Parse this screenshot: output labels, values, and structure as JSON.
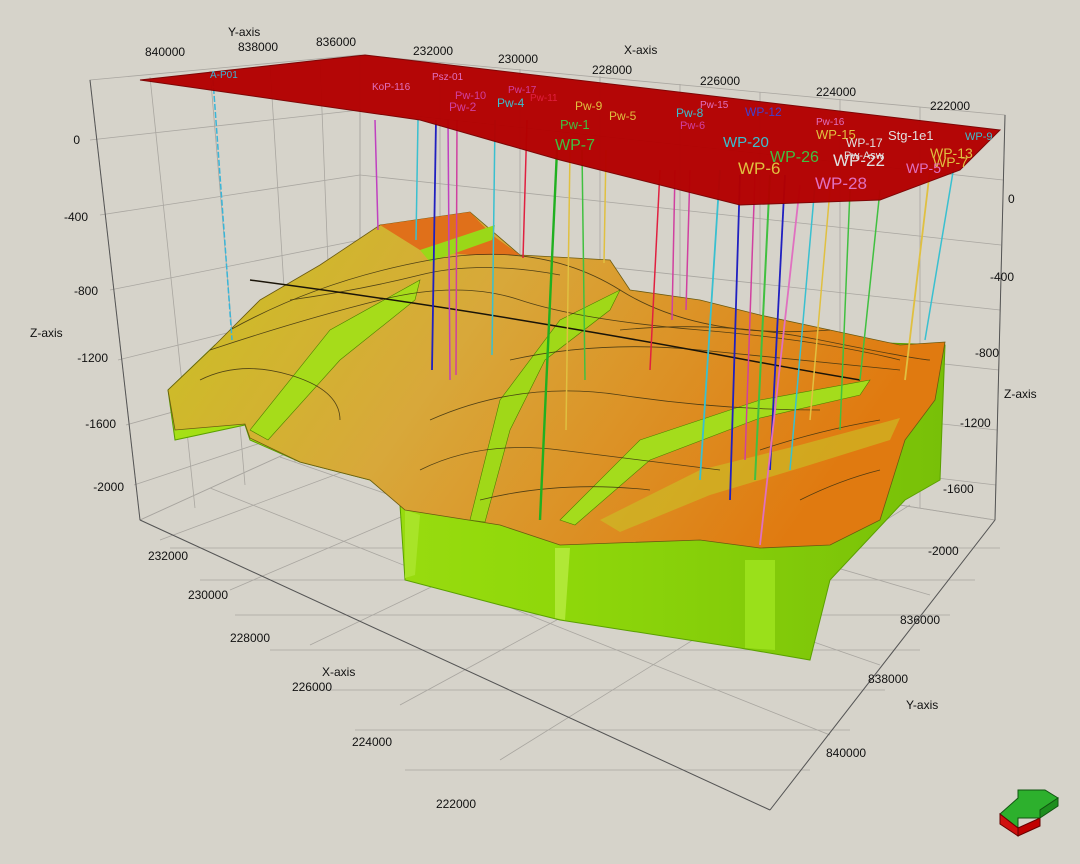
{
  "axes": {
    "x_title": "X-axis",
    "y_title": "Y-axis",
    "z_title": "Z-axis",
    "top_x_ticks": [
      "232000",
      "230000",
      "228000",
      "226000",
      "224000",
      "222000"
    ],
    "top_y_ticks": [
      "840000",
      "838000",
      "836000"
    ],
    "bottom_x_ticks": [
      "232000",
      "230000",
      "228000",
      "226000",
      "224000",
      "222000"
    ],
    "right_y_ticks": [
      "836000",
      "838000",
      "840000"
    ],
    "left_z_ticks": [
      "0",
      "-400",
      "-800",
      "-1200",
      "-1600",
      "-2000"
    ],
    "right_z_ticks": [
      "0",
      "-400",
      "-800",
      "-1200",
      "-1600",
      "-2000"
    ]
  },
  "wells": [
    {
      "name": "A-P01",
      "color": "#39b5d8"
    },
    {
      "name": "Psz-01",
      "color": "#e070c0"
    },
    {
      "name": "KoP-116",
      "color": "#e070c0"
    },
    {
      "name": "Pw-10",
      "color": "#d040a0"
    },
    {
      "name": "Pw-2",
      "color": "#d040a0"
    },
    {
      "name": "Pw-4",
      "color": "#39c0d0"
    },
    {
      "name": "Pw-17",
      "color": "#d040a0"
    },
    {
      "name": "Pw-11",
      "color": "#e02040"
    },
    {
      "name": "Pw-9",
      "color": "#e0c040"
    },
    {
      "name": "Pw-5",
      "color": "#e0c040"
    },
    {
      "name": "Pw-1",
      "color": "#40c040"
    },
    {
      "name": "WP-7",
      "color": "#40c040"
    },
    {
      "name": "Pw-8",
      "color": "#39c0d0"
    },
    {
      "name": "Pw-6",
      "color": "#d040a0"
    },
    {
      "name": "Pw-15",
      "color": "#e070c0"
    },
    {
      "name": "WP-12",
      "color": "#4040d0"
    },
    {
      "name": "WP-20",
      "color": "#39c0d0"
    },
    {
      "name": "WP-6",
      "color": "#e0c040"
    },
    {
      "name": "WP-26",
      "color": "#40c040"
    },
    {
      "name": "WP-22",
      "color": "#e0e0e0"
    },
    {
      "name": "WP-28",
      "color": "#e070c0"
    },
    {
      "name": "WP-15",
      "color": "#e0c040"
    },
    {
      "name": "WP-17",
      "color": "#e0e0e0"
    },
    {
      "name": "Pw-16",
      "color": "#e070c0"
    },
    {
      "name": "Stg-1e1",
      "color": "#e0e0e0"
    },
    {
      "name": "WP-13",
      "color": "#e0c040"
    },
    {
      "name": "WP-9",
      "color": "#39c0d0"
    },
    {
      "name": "WP-7",
      "color": "#e0c040"
    },
    {
      "name": "Pw-Asw",
      "color": "#e0e0e0"
    },
    {
      "name": "WP-5",
      "color": "#e070c0"
    }
  ],
  "colors": {
    "plane": "#b30000",
    "surface_high": "#e07a10",
    "surface_mid": "#d9b830",
    "surface_low": "#c7c520",
    "fault_wall": "#8fd80a",
    "grid": "#a9a6a0",
    "background": "#d6d3ca"
  },
  "navigation": {
    "orientation_icon": "3d-orientation-arrow-icon"
  }
}
